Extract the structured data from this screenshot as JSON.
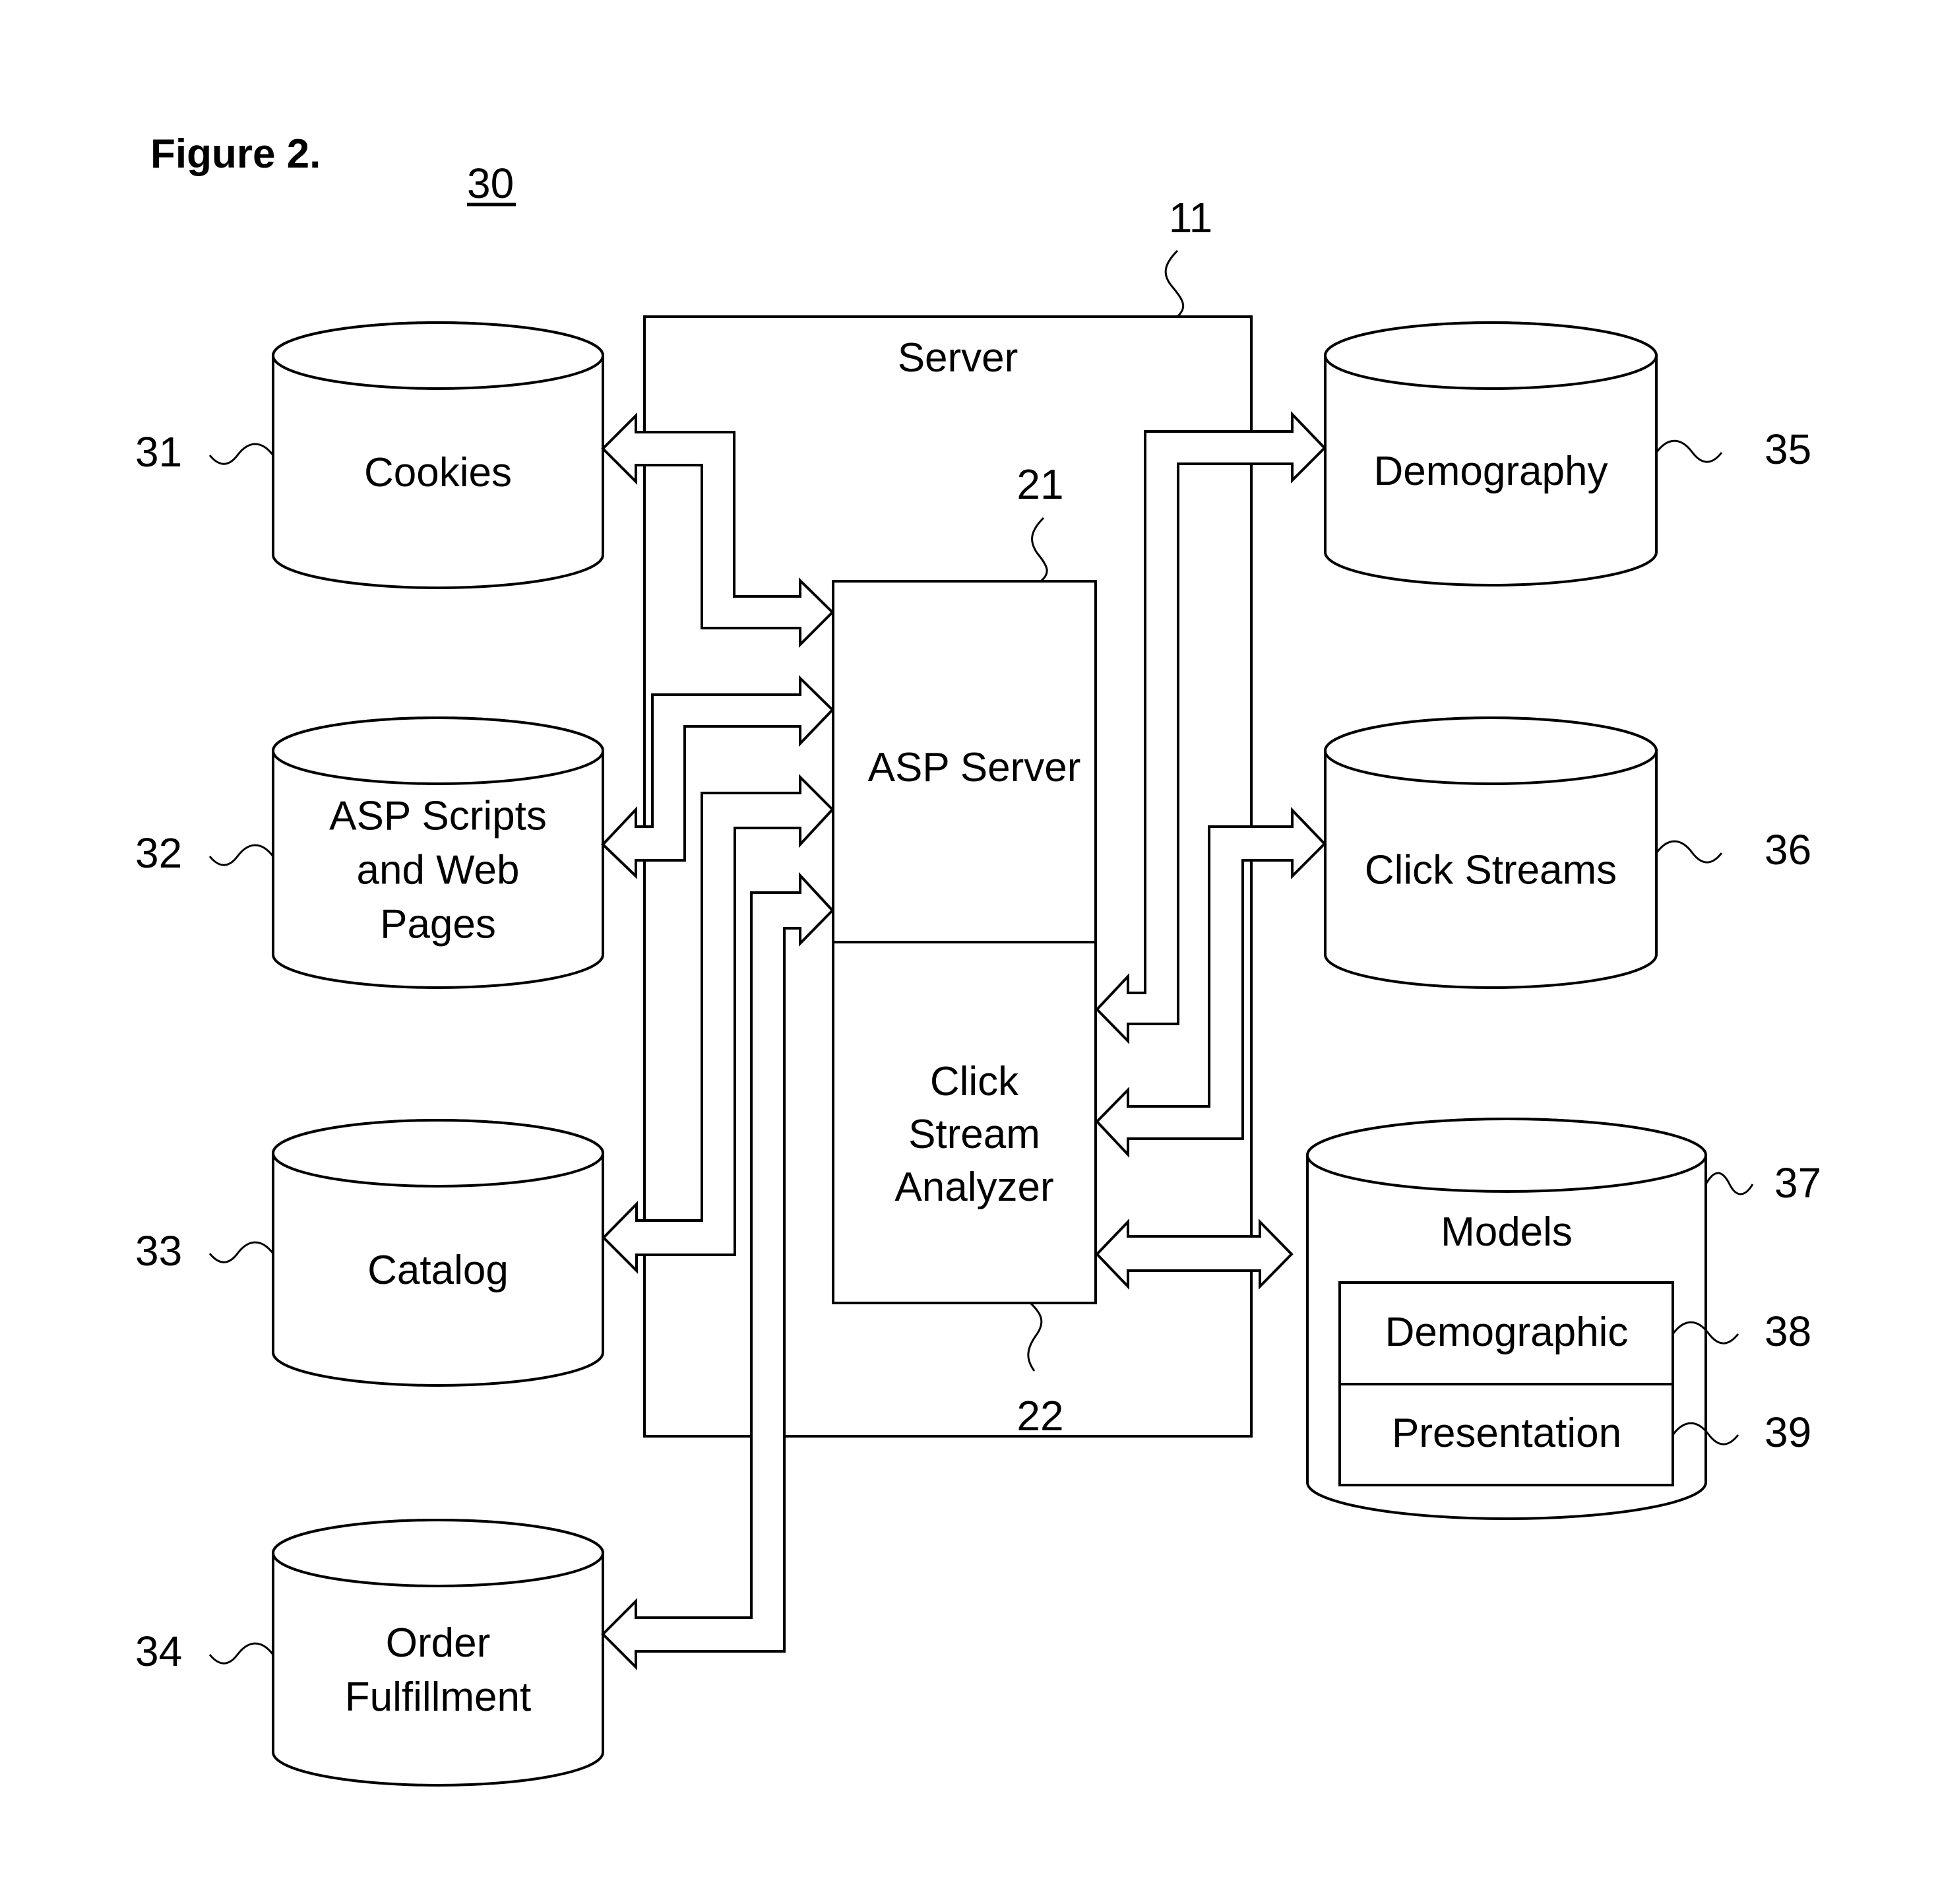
{
  "figure": {
    "title": "Figure 2.",
    "system_ref": "30"
  },
  "server": {
    "label": "Server",
    "ref": "11"
  },
  "asp_server": {
    "label": "ASP Server",
    "ref": "21"
  },
  "analyzer": {
    "label_lines": [
      "Click",
      "Stream",
      "Analyzer"
    ],
    "ref": "22"
  },
  "left_stores": [
    {
      "id": "cookies",
      "label_lines": [
        "Cookies"
      ],
      "ref": "31"
    },
    {
      "id": "asp-scripts",
      "label_lines": [
        "ASP Scripts",
        "and Web",
        "Pages"
      ],
      "ref": "32"
    },
    {
      "id": "catalog",
      "label_lines": [
        "Catalog"
      ],
      "ref": "33"
    },
    {
      "id": "order-fulfillment",
      "label_lines": [
        "Order",
        "Fulfillment"
      ],
      "ref": "34"
    }
  ],
  "right_stores": [
    {
      "id": "demography",
      "label_lines": [
        "Demography"
      ],
      "ref": "35"
    },
    {
      "id": "click-streams",
      "label_lines": [
        "Click Streams"
      ],
      "ref": "36"
    }
  ],
  "models": {
    "label": "Models",
    "ref": "37",
    "sub": [
      {
        "label": "Demographic",
        "ref": "38"
      },
      {
        "label": "Presentation",
        "ref": "39"
      }
    ]
  },
  "connections": [
    {
      "from": "ASP Server",
      "to": "Cookies",
      "direction": "bidirectional"
    },
    {
      "from": "ASP Server",
      "to": "ASP Scripts and Web Pages",
      "direction": "bidirectional"
    },
    {
      "from": "ASP Server",
      "to": "Catalog",
      "direction": "bidirectional"
    },
    {
      "from": "ASP Server",
      "to": "Order Fulfillment",
      "direction": "bidirectional"
    },
    {
      "from": "Click Stream Analyzer",
      "to": "Demography",
      "direction": "bidirectional"
    },
    {
      "from": "Click Stream Analyzer",
      "to": "Click Streams",
      "direction": "bidirectional"
    },
    {
      "from": "Click Stream Analyzer",
      "to": "Models",
      "direction": "bidirectional"
    }
  ]
}
